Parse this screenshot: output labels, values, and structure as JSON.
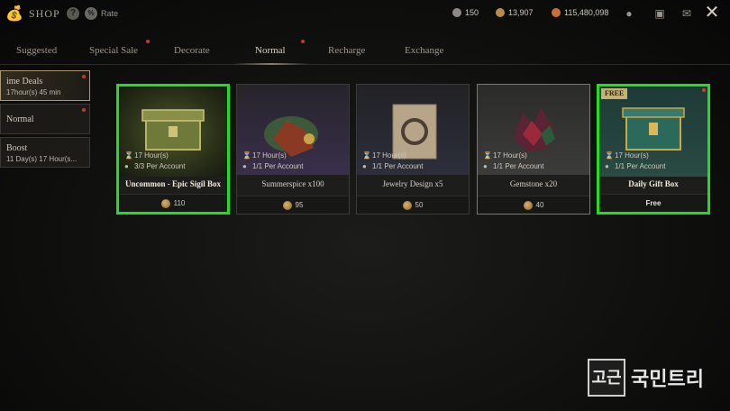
{
  "header": {
    "title": "SHOP",
    "rate_label": "Rate",
    "help_icon": "question-icon",
    "currencies": [
      {
        "icon": "silver-coin-icon",
        "value": "150",
        "color": "#8d8a85"
      },
      {
        "icon": "gold-coin-icon",
        "value": "13,907",
        "color": "#b78c4a"
      },
      {
        "icon": "copper-coin-icon",
        "value": "115,480,098",
        "color": "#c96f3a"
      }
    ]
  },
  "tabs": [
    {
      "label": "Suggested",
      "active": false,
      "dot": false
    },
    {
      "label": "Special Sale",
      "active": false,
      "dot": true
    },
    {
      "label": "Decorate",
      "active": false,
      "dot": false
    },
    {
      "label": "Normal",
      "active": true,
      "dot": true
    },
    {
      "label": "Recharge",
      "active": false,
      "dot": false
    },
    {
      "label": "Exchange",
      "active": false,
      "dot": false
    }
  ],
  "sidebar": [
    {
      "title": "ime Deals",
      "sub": "17hour(s) 45 min",
      "active": true,
      "dot": true
    },
    {
      "title": "Normal",
      "sub": "",
      "active": false,
      "dot": true
    },
    {
      "title": "Boost",
      "sub": "11 Day(s) 17 Hour(s...",
      "active": false,
      "dot": false
    }
  ],
  "cards": [
    {
      "name": "Uncommon - Epic Sigil Box",
      "time": "17 Hour(s)",
      "limit": "3/3 Per Account",
      "price": "110",
      "selected": true,
      "free": false,
      "color": "#2f3a20"
    },
    {
      "name": "Summerspice x100",
      "time": "17 Hour(s)",
      "limit": "1/1 Per Account",
      "price": "95",
      "selected": false,
      "free": false,
      "color": "#3a2e45"
    },
    {
      "name": "Jewelry Design x5",
      "time": "17 Hour(s)",
      "limit": "1/1 Per Account",
      "price": "50",
      "selected": false,
      "free": false,
      "color": "#2b2e38"
    },
    {
      "name": "Gemstone x20",
      "time": "17 Hour(s)",
      "limit": "1/1 Per Account",
      "price": "40",
      "selected": false,
      "free": false,
      "color": "#3a3a38"
    },
    {
      "name": "Daily Gift Box",
      "time": "17 Hour(s)",
      "limit": "1/1 Per Account",
      "price": "Free",
      "selected": true,
      "free": true,
      "free_label": "FREE",
      "color": "#21413a"
    }
  ],
  "watermark": {
    "box_text": "고근",
    "text": "국민트리"
  }
}
